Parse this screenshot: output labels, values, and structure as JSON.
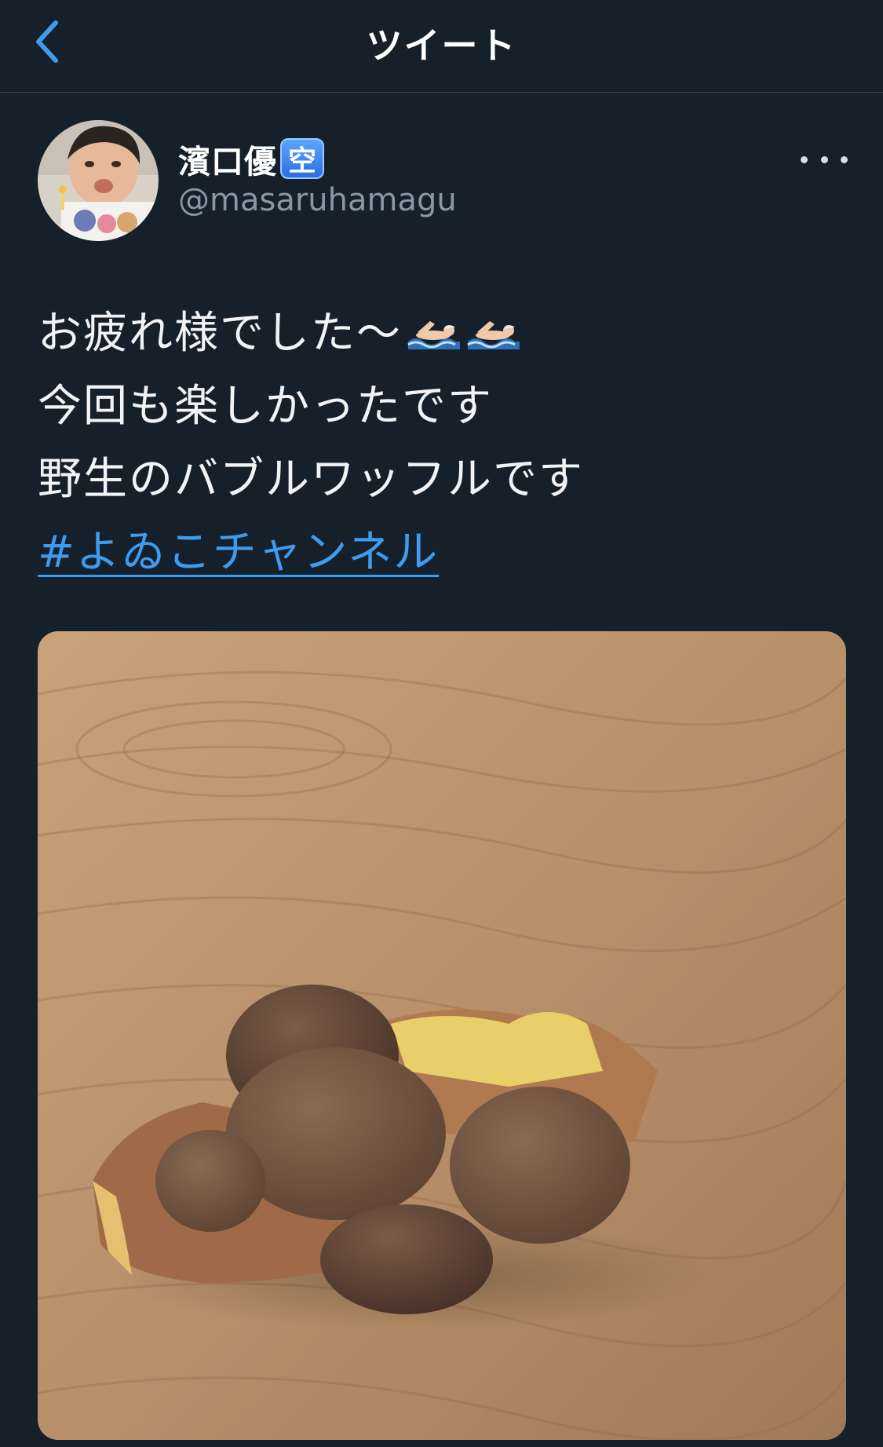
{
  "header": {
    "title": "ツイート"
  },
  "author": {
    "name": "濱口優",
    "badge": "空",
    "handle": "@masaruhamagu"
  },
  "tweet": {
    "lines": [
      "お疲れ様でした〜",
      "今回も楽しかったです",
      "野生のバブルワッフルです"
    ],
    "hashtag": "#よゐこチャンネル"
  },
  "colors": {
    "background": "#15202b",
    "accent": "#3d9cf0",
    "handle": "#8899a6"
  },
  "icons": {
    "back": "chevron-left-icon",
    "more": "more-horizontal-icon",
    "swimmer": "swimmer-emoji"
  }
}
